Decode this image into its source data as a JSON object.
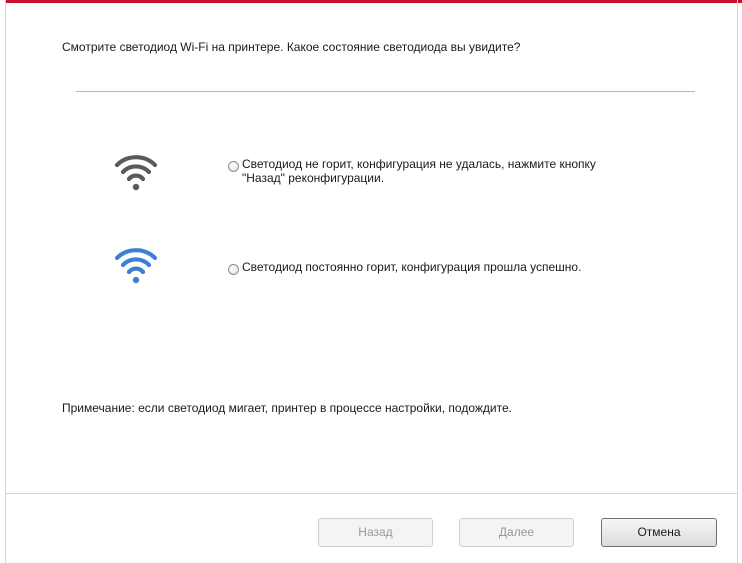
{
  "question": "Смотрите светодиод Wi-Fi на принтере. Какое состояние светодиода вы увидите?",
  "options": [
    {
      "icon": "wifi-icon-off",
      "icon_color": "#5a5a5a",
      "text": "Светодиод не горит,  конфигурация не удалась, нажмите кнопку\n\"Назад\" реконфигурации.",
      "selected": false
    },
    {
      "icon": "wifi-icon-on",
      "icon_color": "#3d7fd6",
      "text": "Светодиод постоянно горит, конфигурация прошла успешно.",
      "selected": false
    }
  ],
  "note": "Примечание: если светодиод мигает, принтер в процессе настройки, подождите.",
  "buttons": {
    "back": "Назад",
    "next": "Далее",
    "cancel": "Отмена"
  },
  "colors": {
    "accent": "#c8102e"
  }
}
